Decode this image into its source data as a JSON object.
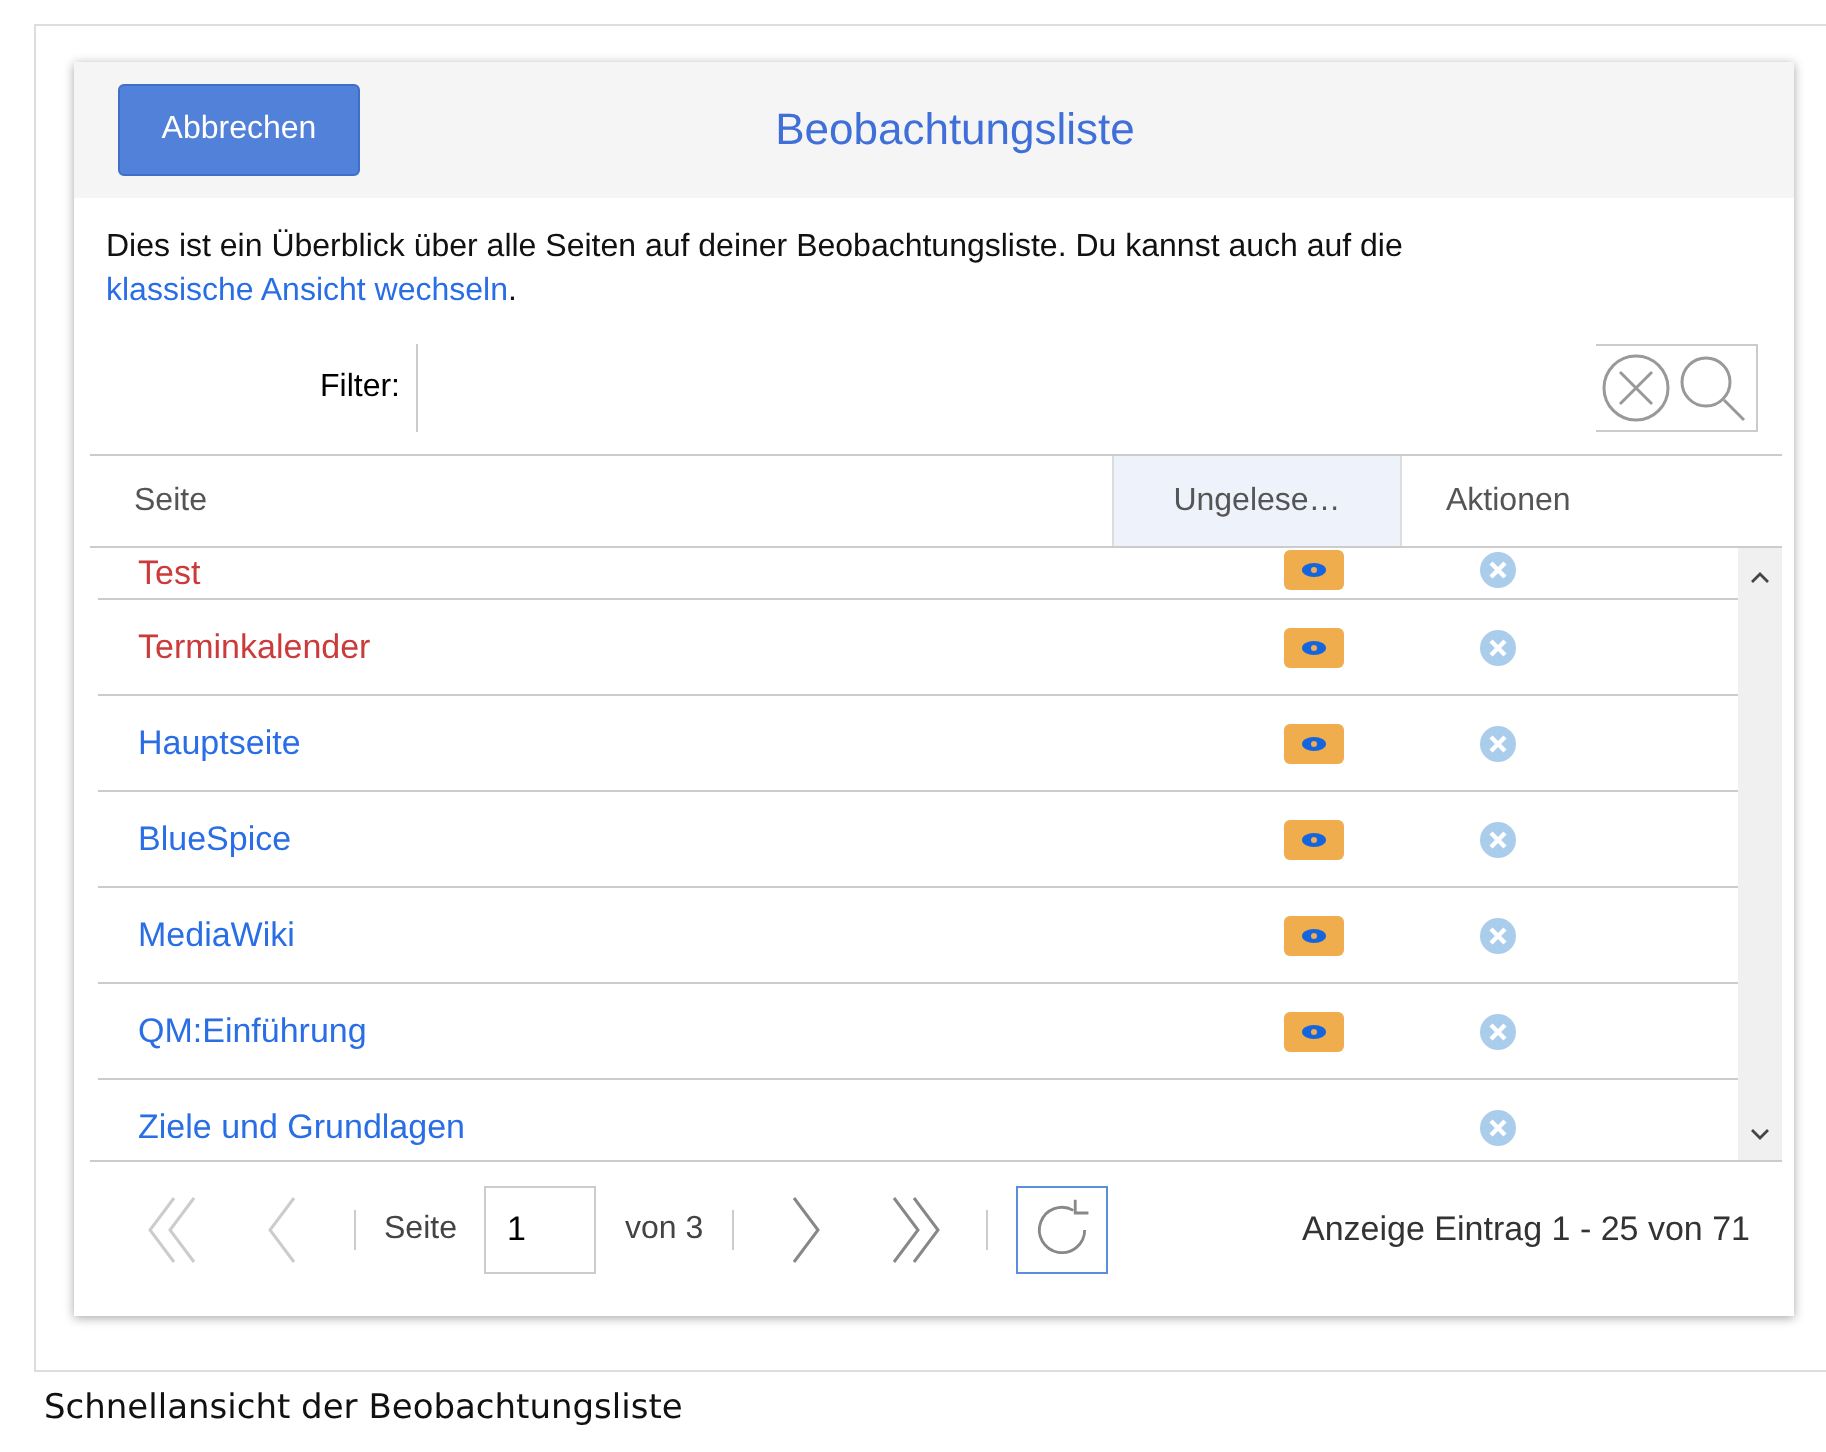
{
  "dialog": {
    "cancel_button": "Abbrechen",
    "title": "Beobachtungsliste"
  },
  "intro": {
    "text": "Dies ist ein Überblick über alle Seiten auf deiner Beobachtungsliste. Du kannst auch auf die ",
    "link": "klassische Ansicht wechseln",
    "after": "."
  },
  "filter": {
    "label": "Filter:"
  },
  "table": {
    "columns": [
      {
        "label": "Seite",
        "selected": false
      },
      {
        "label": "Ungelese…",
        "selected": true
      },
      {
        "label": "Aktionen",
        "selected": false
      }
    ],
    "rows": [
      {
        "page": "Test",
        "exists": false,
        "unread": true
      },
      {
        "page": "Terminkalender",
        "exists": false,
        "unread": true
      },
      {
        "page": "Hauptseite",
        "exists": true,
        "unread": true
      },
      {
        "page": "BlueSpice",
        "exists": true,
        "unread": true
      },
      {
        "page": "MediaWiki",
        "exists": true,
        "unread": true
      },
      {
        "page": "QM:Einführung",
        "exists": true,
        "unread": true
      },
      {
        "page": "Ziele und Grundlagen",
        "exists": true,
        "unread": false
      }
    ]
  },
  "pager": {
    "page_label": "Seite",
    "page": "1",
    "of": "von 3",
    "summary": "Anzeige Eintrag 1 - 25 von 71"
  },
  "caption": "Schnellansicht der Beobachtungsliste"
}
